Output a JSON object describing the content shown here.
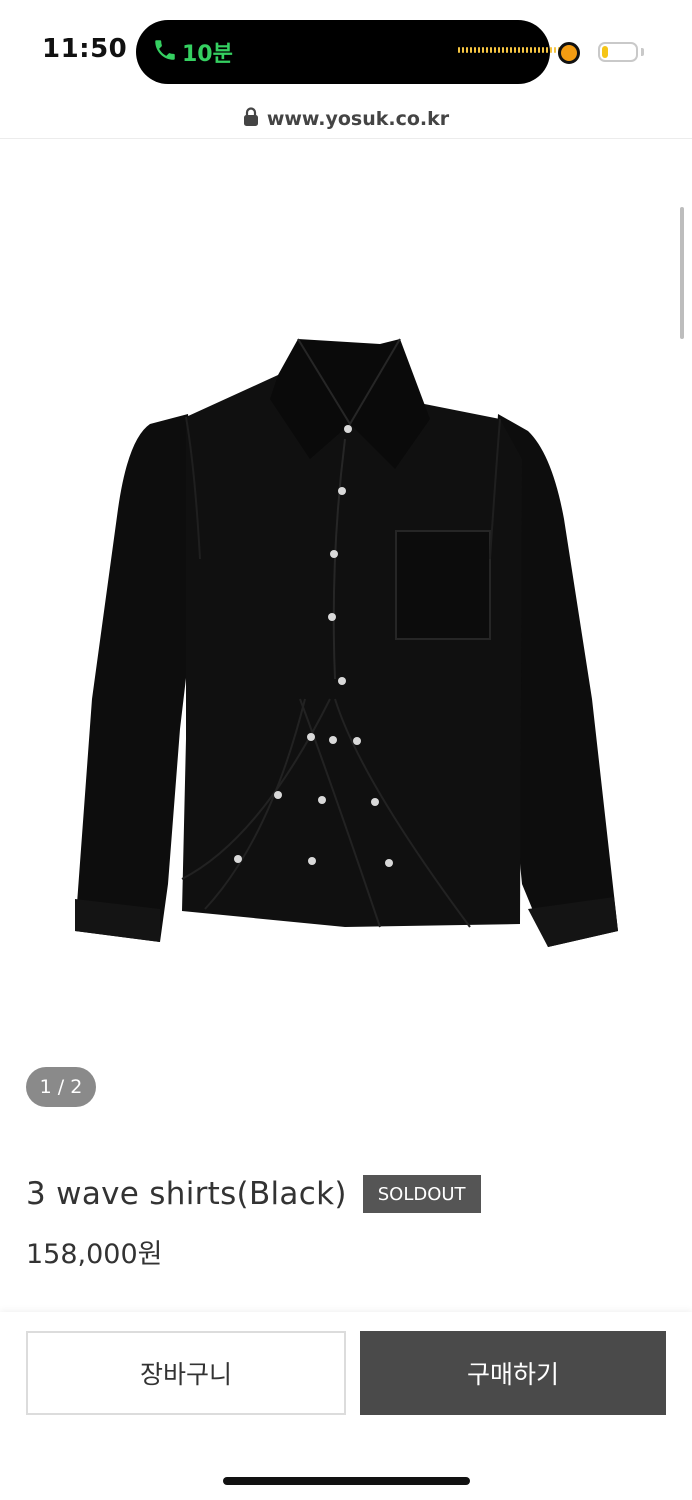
{
  "status_bar": {
    "time": "11:50",
    "call_duration": "10분",
    "call_color": "#35d061",
    "battery_level": 0.2
  },
  "browser": {
    "url": "www.yosuk.co.kr"
  },
  "gallery": {
    "indicator": "1 / 2"
  },
  "product": {
    "name": "3 wave shirts(Black)",
    "badge": "SOLDOUT",
    "price": "158,000원"
  },
  "actions": {
    "cart_label": "장바구니",
    "buy_label": "구매하기"
  }
}
